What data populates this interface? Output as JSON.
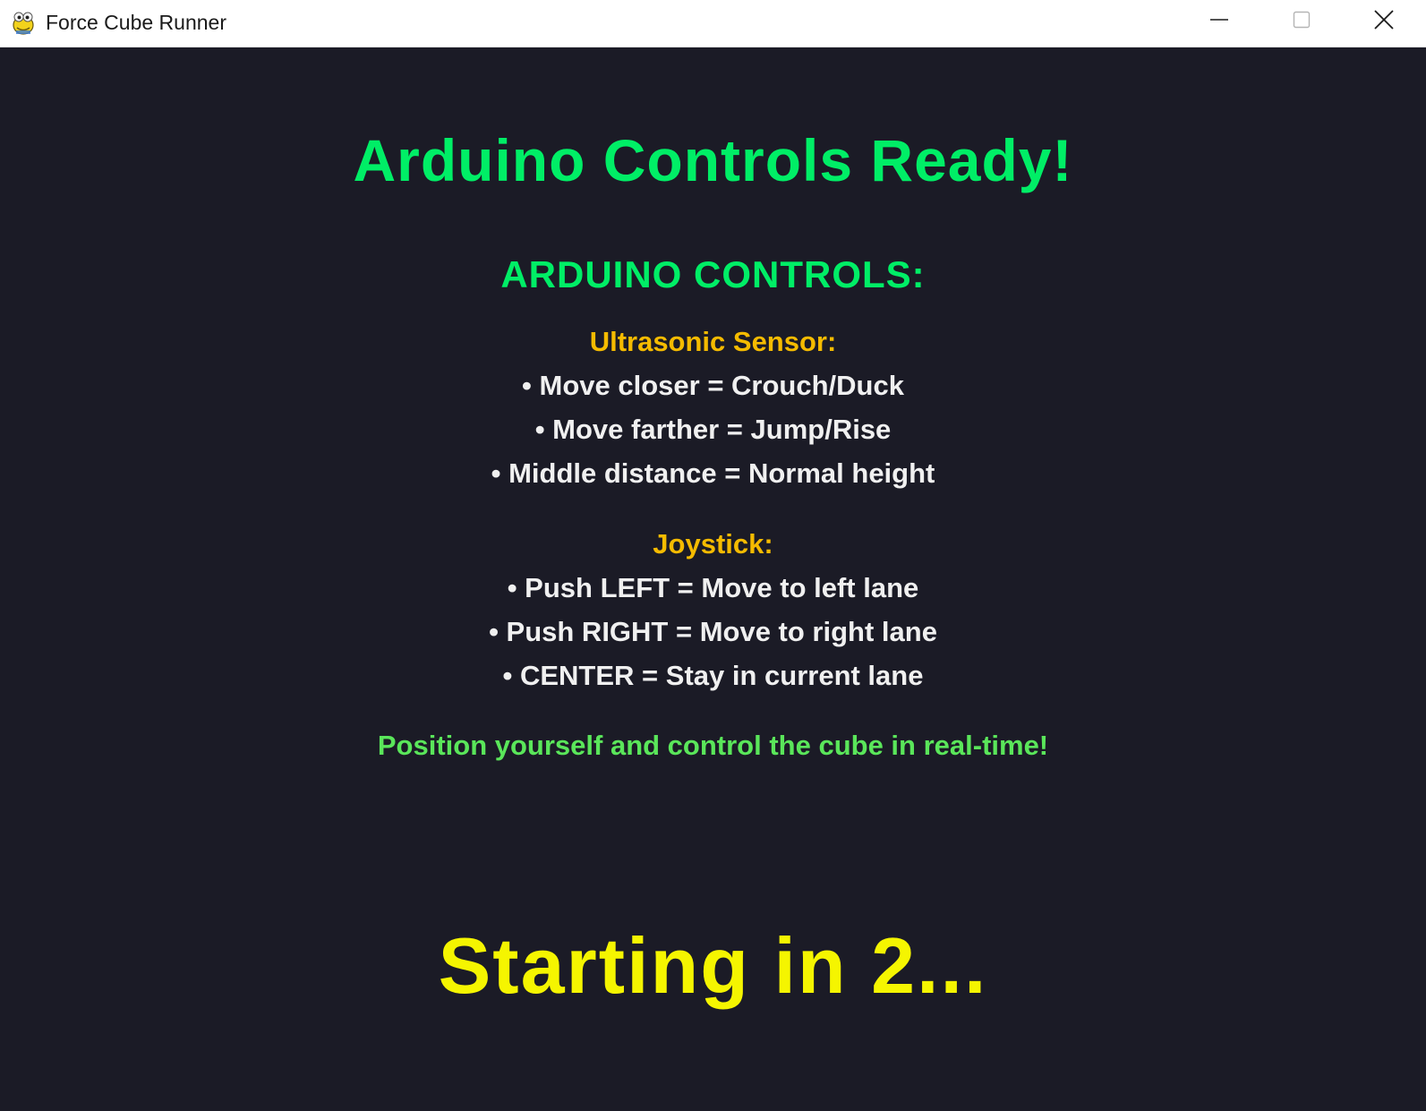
{
  "window": {
    "title": "Force Cube Runner",
    "controls": {
      "minimize_icon": "minimize-icon",
      "maximize_icon": "maximize-icon",
      "close_icon": "close-icon"
    }
  },
  "screen": {
    "heading": "Arduino Controls Ready!",
    "subheading": "ARDUINO CONTROLS:",
    "sections": [
      {
        "title": "Ultrasonic Sensor:",
        "items": [
          "• Move closer = Crouch/Duck",
          "• Move farther = Jump/Rise",
          "• Middle distance = Normal height"
        ]
      },
      {
        "title": "Joystick:",
        "items": [
          "• Push LEFT = Move to left lane",
          "• Push RIGHT = Move to right lane",
          "• CENTER = Stay in current lane"
        ]
      }
    ],
    "note": "Position yourself and control the cube in real-time!",
    "countdown": "Starting in 2..."
  },
  "colors": {
    "background": "#1b1b26",
    "heading": "#00ee66",
    "section_title": "#f5bb00",
    "item_text": "#f0f0f0",
    "note": "#5ae65a",
    "countdown": "#f5f500"
  }
}
